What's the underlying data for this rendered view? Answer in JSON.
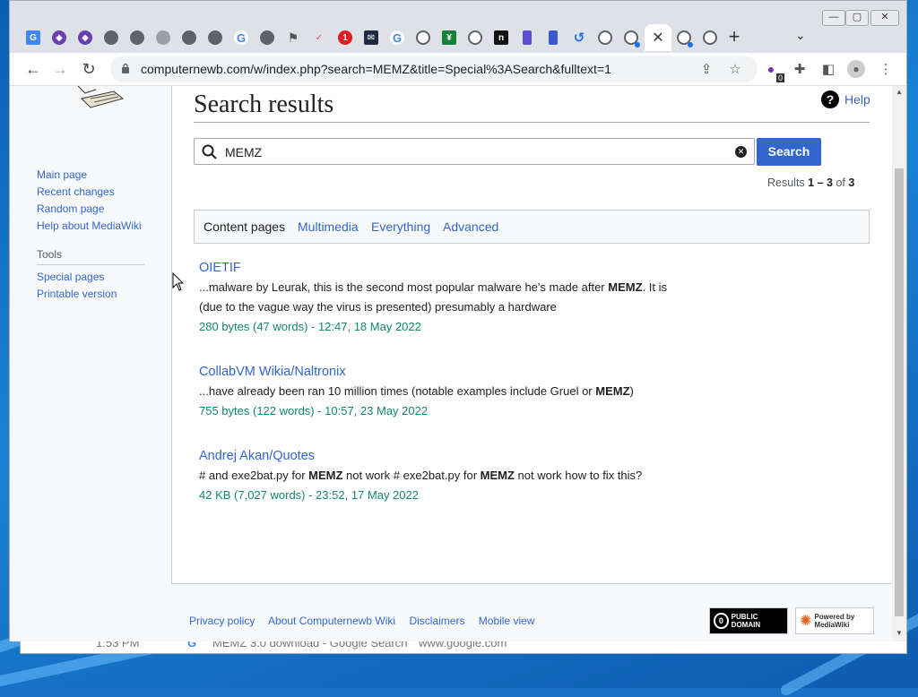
{
  "desktop": {
    "bg_window": {
      "time": "1:53 PM",
      "title": "MEMZ 3.0 download - Google Search",
      "url": "www.google.com"
    }
  },
  "browser": {
    "tabs": [
      {
        "icon": "google-docs-icon",
        "color": "#4285f4",
        "glyph": "G"
      },
      {
        "icon": "purple-shield-icon",
        "color": "#6a3fb3",
        "glyph": "◆"
      },
      {
        "icon": "purple-shield-icon",
        "color": "#6a3fb3",
        "glyph": "◆"
      },
      {
        "icon": "globe-icon",
        "color": "#5f6368",
        "glyph": ""
      },
      {
        "icon": "globe-icon",
        "color": "#5f6368",
        "glyph": ""
      },
      {
        "icon": "globe-icon",
        "color": "#9aa0a6",
        "glyph": ""
      },
      {
        "icon": "globe-icon",
        "color": "#5f6368",
        "glyph": ""
      },
      {
        "icon": "globe-icon",
        "color": "#5f6368",
        "glyph": ""
      },
      {
        "icon": "google-icon",
        "color": "#ffffff",
        "glyph": "G"
      },
      {
        "icon": "globe-icon",
        "color": "#5f6368",
        "glyph": ""
      },
      {
        "icon": "flag-icon",
        "color": "#ffffff",
        "glyph": "⚑"
      },
      {
        "icon": "pocket-icon",
        "color": "#ef4056",
        "glyph": "✓"
      },
      {
        "icon": "notification-badge-icon",
        "color": "#e01b24",
        "glyph": "1"
      },
      {
        "icon": "mail-icon",
        "color": "#1f2a44",
        "glyph": "✉"
      },
      {
        "icon": "google-icon",
        "color": "#ffffff",
        "glyph": "G"
      },
      {
        "icon": "chrome-icon",
        "color": "#5f6368",
        "glyph": ""
      },
      {
        "icon": "sheets-icon",
        "color": "#188038",
        "glyph": "¥"
      },
      {
        "icon": "chrome-icon",
        "color": "#5f6368",
        "glyph": ""
      },
      {
        "icon": "n-icon",
        "color": "#111111",
        "glyph": "n"
      },
      {
        "icon": "book-icon",
        "color": "#5b4fcf",
        "glyph": ""
      },
      {
        "icon": "book-icon",
        "color": "#3b5bcc",
        "glyph": ""
      },
      {
        "icon": "history-icon",
        "color": "#1a73e8",
        "glyph": "↺"
      },
      {
        "icon": "chrome-icon",
        "color": "#5f6368",
        "glyph": ""
      },
      {
        "icon": "chrome-icon",
        "color": "#5f6368",
        "glyph": ""
      },
      {
        "icon": "close-icon",
        "color": "",
        "glyph": "✕",
        "active": true
      },
      {
        "icon": "chrome-icon",
        "color": "#5f6368",
        "glyph": ""
      },
      {
        "icon": "chrome-icon",
        "color": "#5f6368",
        "glyph": ""
      }
    ],
    "new_tab": "+",
    "url": "computernewb.com/w/index.php?search=MEMZ&title=Special%3ASearch&fulltext=1",
    "extension_badge": "0"
  },
  "page": {
    "title": "Search results",
    "help": "Help",
    "search": {
      "value": "MEMZ",
      "button": "Search"
    },
    "results_count": {
      "prefix": "Results ",
      "range": "1 – 3",
      "mid": " of ",
      "total": "3"
    },
    "filters": [
      "Content pages",
      "Multimedia",
      "Everything",
      "Advanced"
    ],
    "sidebar": {
      "nav": [
        "Main page",
        "Recent changes",
        "Random page",
        "Help about MediaWiki"
      ],
      "tools_heading": "Tools",
      "tools": [
        "Special pages",
        "Printable version"
      ]
    },
    "results": [
      {
        "title": "OIETIF",
        "snippet": [
          {
            "t": "...malware by Leurak, this is the second most popular malware he's made after ",
            "b": false
          },
          {
            "t": "MEMZ",
            "b": true
          },
          {
            "t": ". It is (due to the vague way the virus is presented) presumably a hardware",
            "b": false
          }
        ],
        "meta": "280 bytes (47 words) - 12:47, 18 May 2022"
      },
      {
        "title": "CollabVM Wikia/Naltronix",
        "snippet": [
          {
            "t": "...have already been ran 10 million times (notable examples include Gruel or ",
            "b": false
          },
          {
            "t": "MEMZ",
            "b": true
          },
          {
            "t": ")",
            "b": false
          }
        ],
        "meta": "755 bytes (122 words) - 10:57, 23 May 2022"
      },
      {
        "title": "Andrej Akan/Quotes",
        "snippet": [
          {
            "t": "# and exe2bat.py for ",
            "b": false
          },
          {
            "t": "MEMZ",
            "b": true
          },
          {
            "t": " not work # exe2bat.py for ",
            "b": false
          },
          {
            "t": "MEMZ",
            "b": true
          },
          {
            "t": " not work how to fix this?",
            "b": false
          }
        ],
        "meta": "42 KB (7,027 words) - 23:52, 17 May 2022"
      }
    ],
    "footer": [
      "Privacy policy",
      "About Computernewb Wiki",
      "Disclaimers",
      "Mobile view"
    ],
    "badges": {
      "public_domain": "PUBLIC DOMAIN",
      "mediawiki": "Powered by MediaWiki"
    }
  }
}
